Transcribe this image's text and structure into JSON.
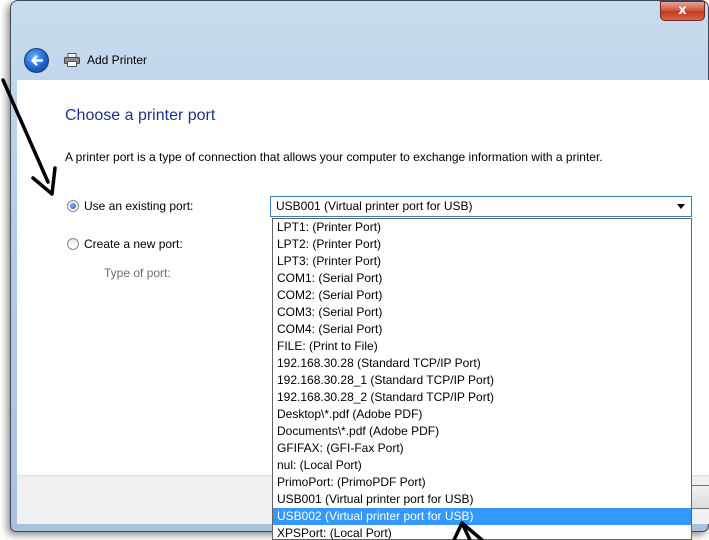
{
  "window": {
    "title": "Add Printer",
    "close_label": "x"
  },
  "page": {
    "heading": "Choose a printer port",
    "description": "A printer port is a type of connection that allows your computer to exchange information with a printer."
  },
  "options": {
    "existing_label": "Use an existing port:",
    "new_label": "Create a new port:",
    "type_label": "Type of port:"
  },
  "port_select": {
    "value": "USB001 (Virtual printer port for USB)",
    "items": [
      "LPT1: (Printer Port)",
      "LPT2: (Printer Port)",
      "LPT3: (Printer Port)",
      "COM1: (Serial Port)",
      "COM2: (Serial Port)",
      "COM3: (Serial Port)",
      "COM4: (Serial Port)",
      "FILE: (Print to File)",
      "192.168.30.28 (Standard TCP/IP Port)",
      "192.168.30.28_1 (Standard TCP/IP Port)",
      "192.168.30.28_2 (Standard TCP/IP Port)",
      "Desktop\\*.pdf (Adobe PDF)",
      "Documents\\*.pdf (Adobe PDF)",
      "GFIFAX: (GFI-Fax Port)",
      "nul: (Local Port)",
      "PrimoPort: (PrimoPDF Port)",
      "USB001 (Virtual printer port for USB)",
      "USB002 (Virtual printer port for USB)",
      "XPSPort: (Local Port)"
    ],
    "highlighted_index": 17
  },
  "icons": {
    "back": "back-arrow-icon",
    "printer": "printer-icon",
    "dropdown": "chevron-down-icon"
  },
  "colors": {
    "heading": "#1e3287",
    "highlight": "#3399ff",
    "close": "#c03a22"
  }
}
